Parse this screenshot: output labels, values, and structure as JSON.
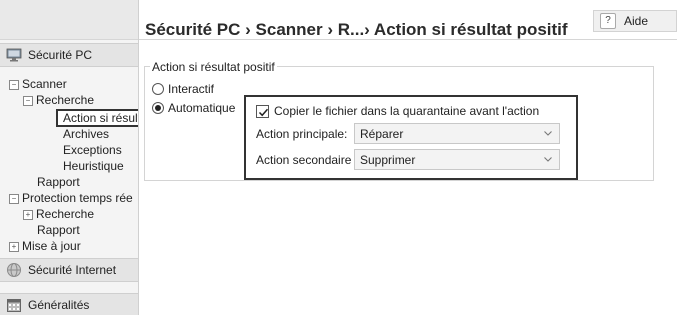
{
  "header": {
    "title": "Sécurité PC › Scanner › R...› Action si résultat positif",
    "help_label": "Aide",
    "help_icon": "?"
  },
  "sidebar": {
    "sections": [
      {
        "label": "Sécurité PC",
        "icon": "monitor-icon"
      },
      {
        "label": "Sécurité Internet",
        "icon": "globe-icon"
      },
      {
        "label": "Généralités",
        "icon": "calendar-icon"
      }
    ],
    "tree": {
      "scanner": "Scanner",
      "recherche": "Recherche",
      "action": "Action si résulta",
      "archives": "Archives",
      "exceptions": "Exceptions",
      "heuristique": "Heuristique",
      "rapport": "Rapport",
      "protection": "Protection temps rée",
      "protection_recherche": "Recherche",
      "protection_rapport": "Rapport",
      "mise_a_jour": "Mise à jour"
    },
    "toggles": {
      "expanded": "−",
      "collapsed": "+"
    }
  },
  "main": {
    "group_label": "Action si résultat positif",
    "option_interactif": "Interactif",
    "option_automatique": "Automatique",
    "selected_option": "Automatique",
    "quarantine_label": "Copier le fichier dans la quarantaine avant l'action",
    "quarantine_checked": true,
    "primary_label": "Action principale:",
    "primary_value": "Réparer",
    "secondary_label": "Action secondaire :",
    "secondary_value": "Supprimer"
  }
}
